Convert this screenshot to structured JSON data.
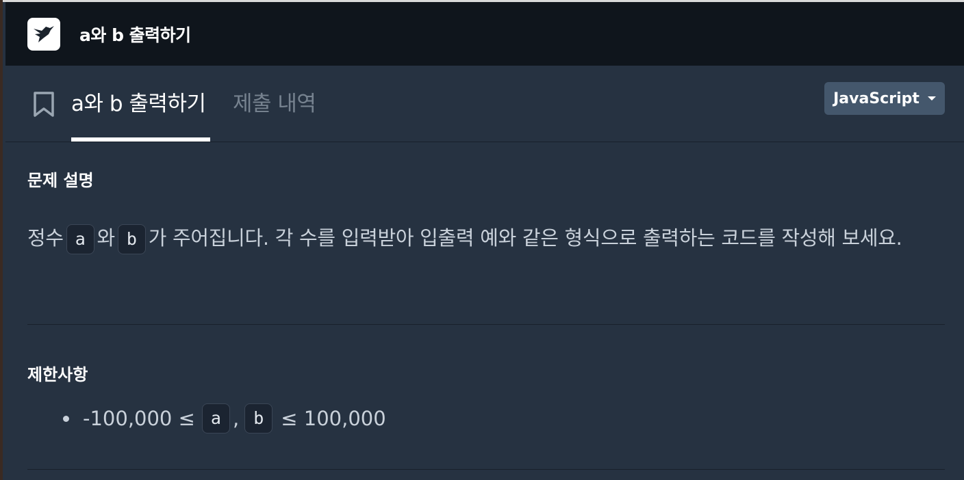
{
  "app": {
    "title": "a와 b 출력하기",
    "logo_icon": "hummingbird-logo-icon"
  },
  "tabs": {
    "bookmark_icon": "bookmark-icon",
    "active_label": "a와 b 출력하기",
    "inactive_label": "제출 내역"
  },
  "language_select": {
    "selected": "JavaScript"
  },
  "problem": {
    "description_title": "문제 설명",
    "description_parts": {
      "p1": "정수",
      "code_a": "a",
      "p2": "와",
      "code_b": "b",
      "p3": "가 주어집니다. 각 수를 입력받아 입출력 예와 같은 형식으로 출력하는 코드를 작성해 보세요."
    },
    "constraints_title": "제한사항",
    "constraint": {
      "prefix": "-100,000 ≤",
      "code_a": "a",
      "sep": ",",
      "code_b": "b",
      "suffix": "≤ 100,000"
    }
  },
  "colors": {
    "titlebar_bg": "#0f151c",
    "page_bg": "#263241",
    "select_bg": "#44576c"
  }
}
